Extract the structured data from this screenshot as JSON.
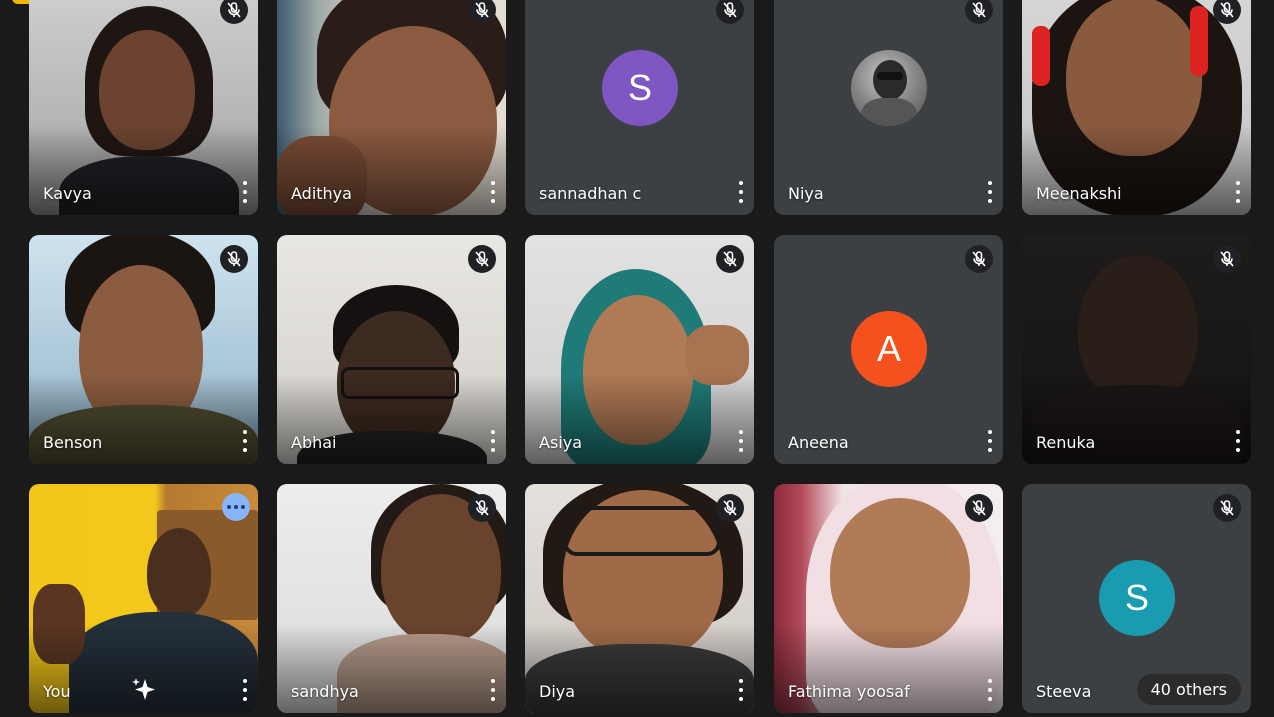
{
  "participants": [
    {
      "name": "Kavya",
      "muted": true,
      "kind": "video"
    },
    {
      "name": "Adithya",
      "muted": true,
      "kind": "video"
    },
    {
      "name": "sannadhan c",
      "muted": true,
      "kind": "initial",
      "initial": "S",
      "color": "#7e57c2"
    },
    {
      "name": "Niya",
      "muted": true,
      "kind": "photo-avatar"
    },
    {
      "name": "Meenakshi",
      "muted": true,
      "kind": "video"
    },
    {
      "name": "Benson",
      "muted": true,
      "kind": "video"
    },
    {
      "name": "Abhai",
      "muted": true,
      "kind": "video"
    },
    {
      "name": "Asiya",
      "muted": true,
      "kind": "video"
    },
    {
      "name": "Aneena",
      "muted": true,
      "kind": "initial",
      "initial": "A",
      "color": "#f4511e"
    },
    {
      "name": "Renuka",
      "muted": true,
      "kind": "video"
    },
    {
      "name": "You",
      "muted": false,
      "kind": "video",
      "self": true
    },
    {
      "name": "sandhya",
      "muted": true,
      "kind": "video"
    },
    {
      "name": "Diya",
      "muted": true,
      "kind": "video"
    },
    {
      "name": "Fathima yoosaf",
      "muted": true,
      "kind": "video"
    },
    {
      "name": "Steeva",
      "muted": true,
      "kind": "initial",
      "initial": "S",
      "color": "#1a9cb0"
    }
  ],
  "others_label": "40 others",
  "icons": {
    "mic_off": "mic-off-icon",
    "more": "more-vert-icon",
    "self_menu": "more-horiz-icon",
    "effects": "sparkle-icon"
  }
}
